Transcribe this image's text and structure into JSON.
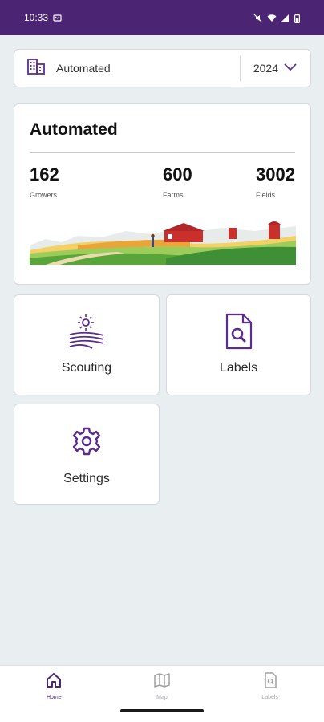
{
  "status_bar": {
    "time": "10:33",
    "indicators": [
      "mute-icon",
      "wifi-icon",
      "signal-icon",
      "battery-icon"
    ]
  },
  "selector": {
    "label": "Automated",
    "year": "2024",
    "icon": "building-icon"
  },
  "summary": {
    "title": "Automated",
    "stats": [
      {
        "value": "162",
        "label": "Growers"
      },
      {
        "value": "600",
        "label": "Farms"
      },
      {
        "value": "3002",
        "label": "Fields"
      }
    ]
  },
  "tiles": {
    "scouting": {
      "label": "Scouting",
      "icon": "sun-field-icon"
    },
    "labels": {
      "label": "Labels",
      "icon": "document-search-icon"
    },
    "settings": {
      "label": "Settings",
      "icon": "gear-icon"
    }
  },
  "bottom_nav": [
    {
      "label": "Home",
      "icon": "home-icon",
      "active": true
    },
    {
      "label": "Map",
      "icon": "map-icon",
      "active": false
    },
    {
      "label": "Labels",
      "icon": "document-search-icon",
      "active": false
    }
  ],
  "colors": {
    "brand": "#4b2473",
    "accent": "#5c2d91",
    "background": "#e9eef1",
    "card": "#ffffff"
  }
}
